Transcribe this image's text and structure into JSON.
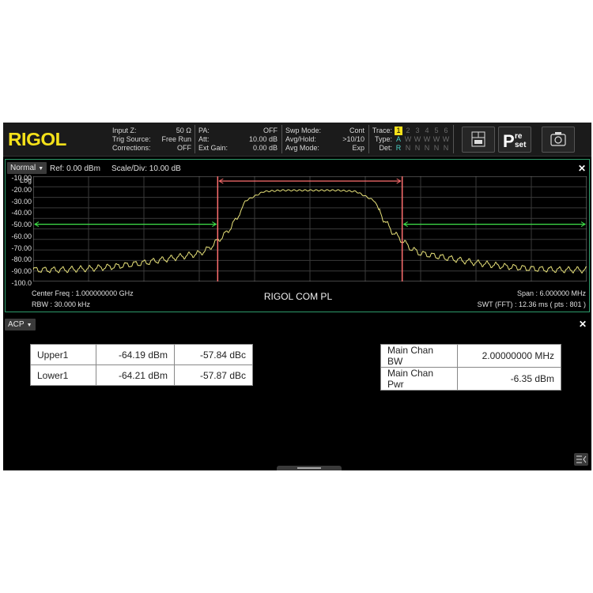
{
  "brand": {
    "logo_text": "RIGOL",
    "logo_color": "#f4e11a"
  },
  "status": {
    "col1": [
      {
        "key": "Input Z:",
        "value": "50 Ω"
      },
      {
        "key": "Trig Source:",
        "value": "Free Run"
      },
      {
        "key": "Corrections:",
        "value": "OFF"
      }
    ],
    "col2": [
      {
        "key": "PA:",
        "value": "OFF"
      },
      {
        "key": "Att:",
        "value": "10.00 dB"
      },
      {
        "key": "Ext Gain:",
        "value": "0.00 dB"
      }
    ],
    "col3": [
      {
        "key": "Swp Mode:",
        "value": "Cont"
      },
      {
        "key": "Avg/Hold:",
        "value": ">10/10"
      },
      {
        "key": "Avg Mode:",
        "value": "Exp"
      }
    ],
    "trace": {
      "trace_label": "Trace:",
      "numbers": [
        "1",
        "2",
        "3",
        "4",
        "5",
        "6"
      ],
      "type_label": "Type:",
      "types": [
        "A",
        "W",
        "W",
        "W",
        "W",
        "W"
      ],
      "det_label": "Det:",
      "dets": [
        "R",
        "N",
        "N",
        "N",
        "N",
        "N"
      ]
    }
  },
  "toolbar": {
    "view_icon": "view-icon",
    "preset_icon": "preset-icon",
    "preset_text_top": "Pre",
    "preset_text_bottom": "set",
    "preset_letter": "P",
    "camera_icon": "camera-icon"
  },
  "spectrum": {
    "mode": "Normal",
    "ref_level": "Ref: 0.00 dBm",
    "scale_div": "Scale/Div: 10.00 dB",
    "y_scale_label": "Log",
    "center_freq": "Center Freq : 1.000000000 GHz",
    "rbw": "RBW : 30.000 kHz",
    "span": "Span : 6.000000 MHz",
    "swt": "SWT (FFT) : 12.36 ms ( pts : 801 )",
    "watermark": "RIGOL COM PL",
    "colors": {
      "trace": "#e8e27a",
      "main_channel": "#ff6f6f",
      "adjacent_channel": "#3fe34a",
      "grid": "#3a3a3a"
    }
  },
  "chart_data": {
    "type": "line",
    "yticks": [
      "-10.00",
      "-20.00",
      "-30.00",
      "-40.00",
      "-50.00",
      "-60.00",
      "-70.00",
      "-80.00",
      "-90.00",
      "-100.0"
    ],
    "ylim": [
      -100,
      -10
    ],
    "xlim_mhz": [
      997,
      1003
    ],
    "grid": true,
    "series": [
      {
        "x": [
          997.0,
          997.3,
          997.6,
          997.9,
          998.2,
          998.5,
          998.8,
          998.9,
          999.0,
          999.1,
          999.2,
          999.3,
          999.5,
          999.7,
          1000.0,
          1000.3,
          1000.5,
          1000.7,
          1000.8,
          1000.9,
          1001.0,
          1001.1,
          1001.2,
          1001.5,
          1001.8,
          1002.1,
          1002.4,
          1002.7,
          1003.0
        ],
        "y": [
          -90,
          -90,
          -89,
          -87,
          -84,
          -80,
          -76,
          -72,
          -65,
          -58,
          -47,
          -31,
          -23,
          -22,
          -22,
          -22,
          -23,
          -31,
          -47,
          -58,
          -65,
          -72,
          -76,
          -80,
          -84,
          -87,
          -89,
          -90,
          -90
        ]
      }
    ],
    "main_channel_mhz": [
      999.0,
      1001.0
    ],
    "adjacent_channels_mhz": [
      [
        997.0,
        999.0
      ],
      [
        1001.0,
        1003.0
      ]
    ],
    "adjacent_level_dbm": -51
  },
  "acp": {
    "mode": "ACP",
    "left_table": [
      [
        "Upper1",
        "-64.19 dBm",
        "-57.84 dBc"
      ],
      [
        "Lower1",
        "-64.21 dBm",
        "-57.87 dBc"
      ]
    ],
    "right_table": [
      [
        "Main Chan BW",
        "2.00000000 MHz"
      ],
      [
        "Main Chan Pwr",
        "-6.35 dBm"
      ]
    ]
  }
}
